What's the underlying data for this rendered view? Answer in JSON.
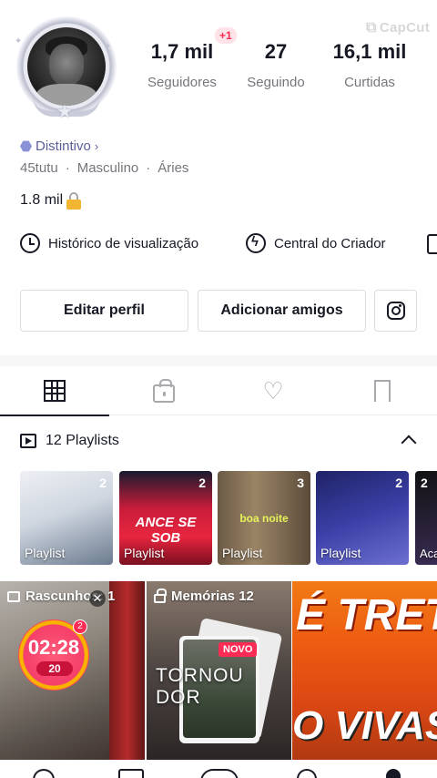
{
  "watermark": {
    "text": "CapCut"
  },
  "profile": {
    "stats": [
      {
        "value": "1,7 mil",
        "label": "Seguidores"
      },
      {
        "value": "27",
        "label": "Seguindo"
      },
      {
        "value": "16,1 mil",
        "label": "Curtidas"
      }
    ],
    "followers_delta": "+1",
    "badge": "Distintivo",
    "username": "45tutu",
    "gender": "Masculino",
    "sign": "Áries",
    "bio": "1.8 mil"
  },
  "quick_links": [
    {
      "label": "Histórico de visualização",
      "icon": "clock-icon"
    },
    {
      "label": "Central do Criador",
      "icon": "bolt-icon"
    }
  ],
  "actions": {
    "edit_profile": "Editar perfil",
    "add_friends": "Adicionar amigos",
    "instagram_icon": "instagram-icon"
  },
  "tabs": [
    {
      "icon": "grid-icon",
      "active": true
    },
    {
      "icon": "lock-icon",
      "active": false
    },
    {
      "icon": "heart-icon",
      "active": false
    },
    {
      "icon": "bookmark-icon",
      "active": false
    }
  ],
  "playlists": {
    "header": "12 Playlists",
    "items": [
      {
        "name": "Playlist",
        "count": "2",
        "overlay": ""
      },
      {
        "name": "Playlist",
        "count": "2",
        "overlay": "ANCE SE SOB"
      },
      {
        "name": "Playlist",
        "count": "3",
        "overlay": "boa noite"
      },
      {
        "name": "Playlist",
        "count": "2",
        "overlay": ""
      },
      {
        "name": "Aca rev",
        "count": "2",
        "overlay": ""
      }
    ]
  },
  "videos": [
    {
      "label": "Rascunhos: 1",
      "timer": "02:28",
      "coins": "20",
      "notif": "2"
    },
    {
      "label": "Memórias 12",
      "tag": "NOVO",
      "caption": "TORNOU DOR"
    },
    {
      "label": "",
      "caption_top": "É TRETA!",
      "caption_bottom": "O VIVAS"
    }
  ],
  "colors": {
    "accent": "#fe2c55",
    "text": "#161823",
    "muted": "#75767c",
    "badge": "#5b5e9b"
  }
}
